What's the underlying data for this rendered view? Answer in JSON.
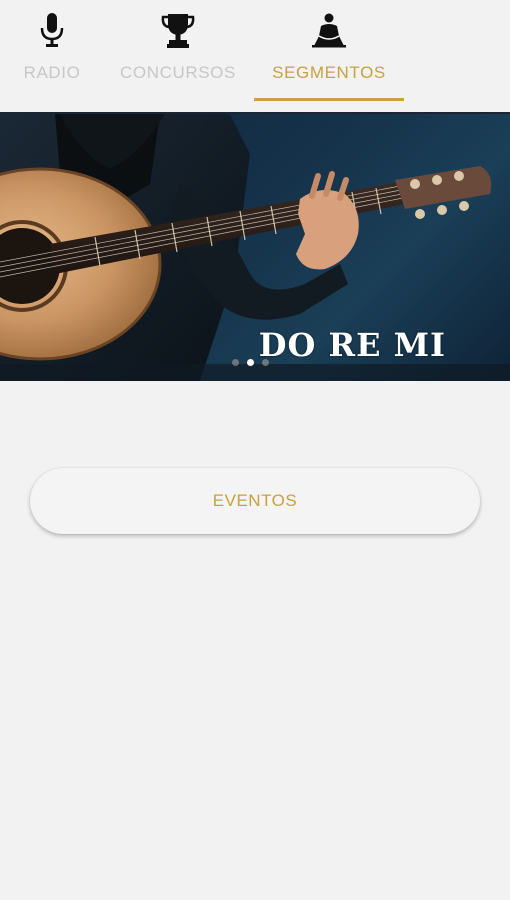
{
  "tabs": [
    {
      "label": "RADIO",
      "icon": "microphone-icon",
      "active": false
    },
    {
      "label": "CONCURSOS",
      "icon": "trophy-icon",
      "active": false
    },
    {
      "label": "SEGMENTOS",
      "icon": "meditation-person-icon",
      "active": true
    }
  ],
  "banner": {
    "title": "DO RE MI",
    "slide_count": 3,
    "active_slide": 2
  },
  "buttons": {
    "eventos_label": "EVENTOS"
  },
  "colors": {
    "accent": "#c9a23f",
    "inactive_tab": "#c7c7c7",
    "background": "#f2f2f2"
  }
}
